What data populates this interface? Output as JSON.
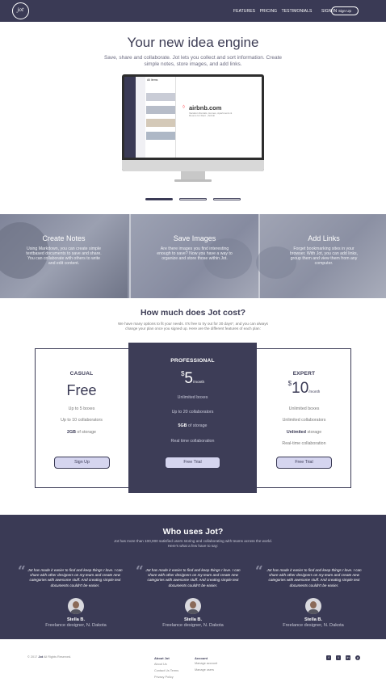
{
  "nav": {
    "logo": "jot",
    "links": [
      "FEATURES",
      "PRICING",
      "TESTIMONIALS",
      "SIGN IN"
    ],
    "signup": "Sign Up"
  },
  "hero": {
    "title": "Your new idea engine",
    "subtitle": "Save, share and collaborate. Jot lets you collect and sort information. Create simple notes, store images, and add links.",
    "screen_site": "airbnb.com",
    "screen_desc": "Vacation Rentals, Homes, Apartments & Rooms for Rent - Airbnb",
    "screen_header": "All Items"
  },
  "features": [
    {
      "title": "Create Notes",
      "text": "Using Markdown, you can create simple textbased documents to save and share. You can collaborate with others to write and edit content."
    },
    {
      "title": "Save Images",
      "text": "Are there images you find interesting enough to save? Now you have a way to organize and store those within Jot."
    },
    {
      "title": "Add Links",
      "text": "Forget bookmarking sites in your browser. With Jot, you can add links, group them and view them from any computer."
    }
  ],
  "pricing": {
    "title": "How much does Jot cost?",
    "subtitle": "We have many options to fit your needs. It's free to try out for 30 days*, and you can always change your plan once you signed up. Here are the different features of each plan:",
    "casual": {
      "name": "CASUAL",
      "price": "Free",
      "f1": "Up to 5 boxes",
      "f2": "Up to 10 collaborators",
      "f3_bold": "2GB",
      "f3": " of storage",
      "button": "Sign Up"
    },
    "pro": {
      "name": "PROFESSIONAL",
      "currency": "$",
      "price": "5",
      "per": "/month",
      "f1": "Unlimited boxes",
      "f2": "Up to 20 collaborators",
      "f3_bold": "5GB",
      "f3": " of storage",
      "f4": "Real time collaboration",
      "button": "Free Trial"
    },
    "expert": {
      "name": "EXPERT",
      "currency": "$",
      "price": "10",
      "per": "/month",
      "f1": "Unlimited boxes",
      "f2": "Unlimited collaborators",
      "f3_bold": "Unlimited",
      "f3": " storage",
      "f4": "Real-time collaboration",
      "button": "Free Trial"
    }
  },
  "testimonials": {
    "title": "Who uses Jot?",
    "subtitle": "Jot has more than 100,000 satisfied users storing and collaborating with teams across the world. Here's what a few have to say:",
    "items": [
      {
        "quote": "Jot has made it easier to find and keep things I love.  I can share with other designers on my team and create new categories with awesome stuff.  And creating simple text documents couldn't be easier.",
        "name": "Stella B.",
        "role": "Freelance designer, N. Dakota"
      },
      {
        "quote": "Jot has made it easier to find and keep things I love.  I can share with other designers on my team and create new categories with awesome stuff.  And creating simple text documents couldn't be easier.",
        "name": "Stella B.",
        "role": "Freelance designer, N. Dakota"
      },
      {
        "quote": "Jot has made it easier to find and keep things I love.  I can share with other designers on my team and create new categories with awesome stuff.  And creating simple text documents couldn't be easier.",
        "name": "Stella B.",
        "role": "Freelance designer, N. Dakota"
      }
    ]
  },
  "footer": {
    "copyright_prefix": "© 2017",
    "copyright_brand": "Jot",
    "copyright_suffix": "All Rights Reserved.",
    "col1_title": "About Jot",
    "col1_links": [
      "About Us",
      "Contact Us Terms",
      "Privacy Policy"
    ],
    "col2_title": "Account",
    "col2_links": [
      "Manage account",
      "Manage users"
    ],
    "social": [
      "facebook-icon",
      "twitter-icon",
      "linkedin-icon",
      "pinterest-icon"
    ]
  },
  "colors": {
    "navy": "#3a3a55",
    "button_fill": "#d5d5ef",
    "features_bg": "#8e93a5"
  }
}
